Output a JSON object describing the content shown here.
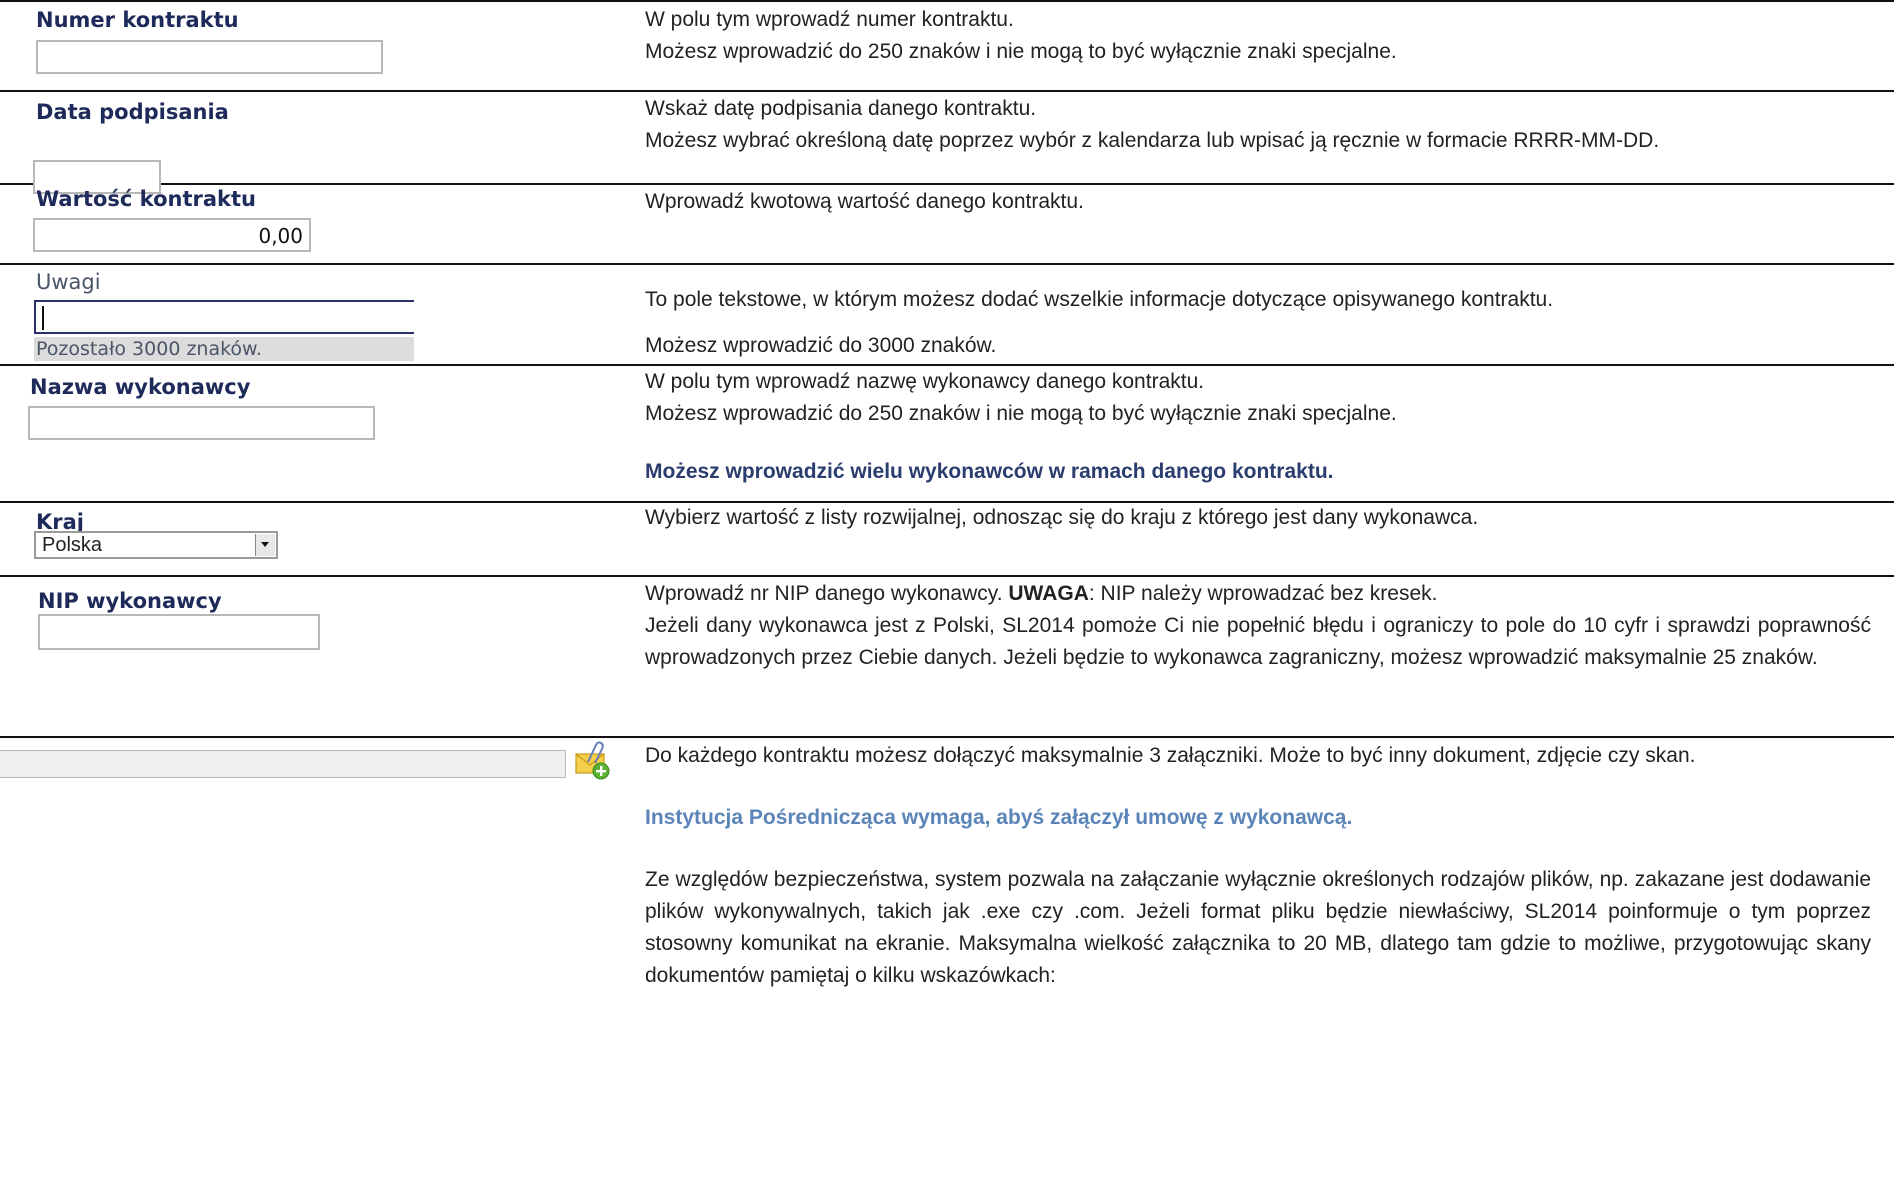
{
  "fields": {
    "numer": {
      "label": "Numer kontraktu",
      "value": ""
    },
    "data": {
      "label": "Data podpisania",
      "value": ""
    },
    "wartosc": {
      "label": "Wartość kontraktu",
      "value": "0,00"
    },
    "uwagi": {
      "label": "Uwagi",
      "value": "",
      "counter": "Pozostało 3000 znaków."
    },
    "nazwa": {
      "label": "Nazwa wykonawcy",
      "value": ""
    },
    "kraj": {
      "label": "Kraj",
      "selected": "Polska"
    },
    "nip": {
      "label": "NIP wykonawcy",
      "value": ""
    },
    "zalacznik": {
      "value": ""
    }
  },
  "desc": {
    "numer": [
      "W polu tym wprowadź numer kontraktu.",
      "Możesz wprowadzić do 250 znaków i nie mogą to być wyłącznie znaki specjalne."
    ],
    "data": [
      "Wskaż datę podpisania danego kontraktu.",
      "Możesz wybrać określoną datę poprzez wybór z kalendarza lub wpisać ją ręcznie w formacie RRRR-MM-DD."
    ],
    "wartosc": [
      "Wprowadź kwotową wartość danego kontraktu."
    ],
    "uwagi": [
      "To pole tekstowe, w którym możesz dodać wszelkie informacje dotyczące opisywanego kontraktu.",
      "Możesz wprowadzić do 3000 znaków."
    ],
    "nazwa": [
      "W polu tym wprowadź nazwę wykonawcy danego kontraktu.",
      "Możesz wprowadzić do 250 znaków i nie mogą to być wyłącznie znaki specjalne.",
      "Możesz wprowadzić wielu wykonawców w ramach danego kontraktu."
    ],
    "kraj": [
      "Wybierz wartość z listy rozwijalnej, odnosząc się do kraju z którego jest dany wykonawca."
    ],
    "nip": {
      "intro": "Wprowadź nr NIP danego wykonawcy. ",
      "uwaga": "UWAGA",
      "intro_rest": ": NIP należy wprowadzać bez kresek.",
      "body": "Jeżeli dany wykonawca jest z Polski, SL2014 pomoże Ci nie popełnić błędu i ograniczy to pole do 10 cyfr i sprawdzi poprawność wprowadzonych przez Ciebie danych. Jeżeli będzie to wykonawca zagraniczny, możesz wprowadzić maksymalnie 25 znaków."
    },
    "zalacznik": [
      "Do każdego kontraktu możesz dołączyć maksymalnie 3 załączniki. Może to być inny dokument, zdjęcie czy skan.",
      "Instytucja Pośrednicząca wymaga, abyś załączył umowę z wykonawcą.",
      "Ze względów bezpieczeństwa, system pozwala na  załączanie wyłącznie określonych rodzajów plików, np. zakazane jest dodawanie plików wykonywalnych, takich jak .exe czy .com. Jeżeli format pliku będzie niewłaściwy, SL2014 poinformuje o tym poprzez stosowny komunikat na ekranie. Maksymalna wielkość załącznika to 20 MB, dlatego tam gdzie to możliwe, przygotowując skany dokumentów pamiętaj o kilku wskazówkach:"
    ]
  },
  "icons": {
    "attach": "attachment-add-icon",
    "dropdown": "chevron-down-icon"
  },
  "colors": {
    "label": "#1e2a5a",
    "note": "#2b3d6e",
    "accent": "#5b84b8"
  }
}
